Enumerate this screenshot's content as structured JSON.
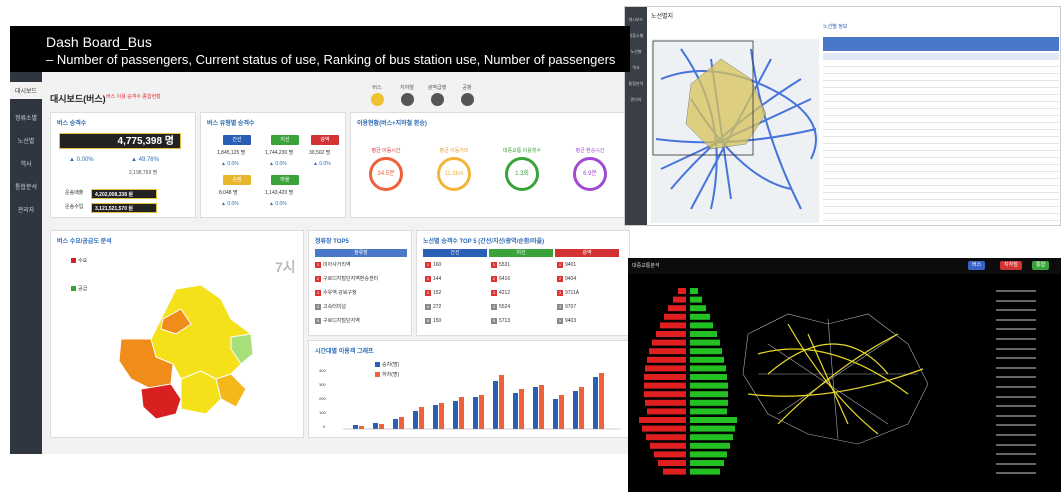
{
  "banner": {
    "title": "Dash Board_Bus",
    "subtitle": "– Number of passengers, Current status of use, Ranking of bus station use, Number of passengers"
  },
  "dashboard": {
    "nav": [
      "대시보드",
      "정류소별",
      "노선별",
      "역사",
      "통합분석",
      "관리자"
    ],
    "title": "대시보드(버스)",
    "subtitle": "버스 이용 승객수 종합현황",
    "filters": [
      "버스",
      "지하철",
      "광역급행",
      "공항"
    ],
    "passengers": {
      "title": "버스 승객수",
      "total": "4,775,398 명",
      "pct_left": "▲ 0.00%",
      "pct_right": "▲ 49.76%",
      "compare": "2,198,769 명",
      "revenue_label": "운송매출",
      "revenue": "4,202,008,338 원",
      "income_label": "운송수입",
      "income": "3,121,521,570 원"
    },
    "bus_types": {
      "title": "버스 유형별 승객수",
      "items": [
        {
          "name": "간선",
          "value": "1,845,125 명",
          "pct": "▲ 0.0%",
          "color": "#2a5fb6"
        },
        {
          "name": "지선",
          "value": "1,744,230 명",
          "pct": "▲ 0.0%",
          "color": "#3aa33a"
        },
        {
          "name": "광역",
          "value": "30,502 명",
          "pct": "▲ 0.0%",
          "color": "#d33333"
        },
        {
          "name": "순환",
          "value": "8,048 명",
          "pct": "▲ 0.0%",
          "color": "#e8b62a"
        },
        {
          "name": "마을",
          "value": "1,143,420 명",
          "pct": "▲ 0.0%",
          "color": "#3aa33a"
        }
      ]
    },
    "usage": {
      "title": "이용현황(버스+지하철 환승)",
      "gauges": [
        {
          "label": "평균 이동시간",
          "value": "34.5분",
          "color": "#f0603a"
        },
        {
          "label": "평균 이동거리",
          "value": "11.3km",
          "color": "#f3b53a"
        },
        {
          "label": "대중교통 이용횟수",
          "value": "1.3회",
          "color": "#3aa33a"
        },
        {
          "label": "평균 환승시간",
          "value": "6.9분",
          "color": "#a24ad3"
        }
      ]
    },
    "demand_map": {
      "title": "버스 수요/공급도 분석",
      "hour": "7시",
      "legend_high": "수요",
      "legend_low": "공급"
    },
    "stop_top5": {
      "title": "정류장 TOP5",
      "header": "정류장",
      "rows": [
        "미아사거리역",
        "구로디지털단지역환승센터",
        "수유역.강북구청",
        "고속터미널",
        "구로디지털단지역"
      ]
    },
    "route_top5": {
      "title": "노선별 승객수 TOP 5 (간선/지선/광역/순환/마을)",
      "headers": [
        "간선",
        "지선",
        "광역"
      ],
      "header_colors": [
        "#2a5fb6",
        "#3aa33a",
        "#d33333"
      ],
      "col1": [
        "160",
        "144",
        "152",
        "272",
        "150"
      ],
      "col2": [
        "5531",
        "6416",
        "4212",
        "5524",
        "5713"
      ],
      "col3": [
        "9401",
        "9404",
        "9711A",
        "9707",
        "9403"
      ]
    },
    "time_chart": {
      "title": "시간대별 이용객 그래프",
      "series": [
        {
          "name": "승차(명)",
          "color": "#2a5fb6"
        },
        {
          "name": "하차(명)",
          "color": "#f0603a"
        }
      ],
      "yticks": [
        "400",
        "300",
        "200",
        "100",
        "0"
      ]
    }
  },
  "top_right": {
    "title": "노선별지",
    "nav": [
      "대시보드",
      "정류소별",
      "노선별",
      "역사",
      "통합분석",
      "관리자"
    ],
    "table_title": "노선별 정보"
  },
  "bottom_right": {
    "title": "대중교통분석",
    "buttons": [
      {
        "label": "버스",
        "color": "#3a63c8"
      },
      {
        "label": "지하철",
        "color": "#d33333"
      },
      {
        "label": "통합",
        "color": "#3aa33a"
      }
    ]
  }
}
